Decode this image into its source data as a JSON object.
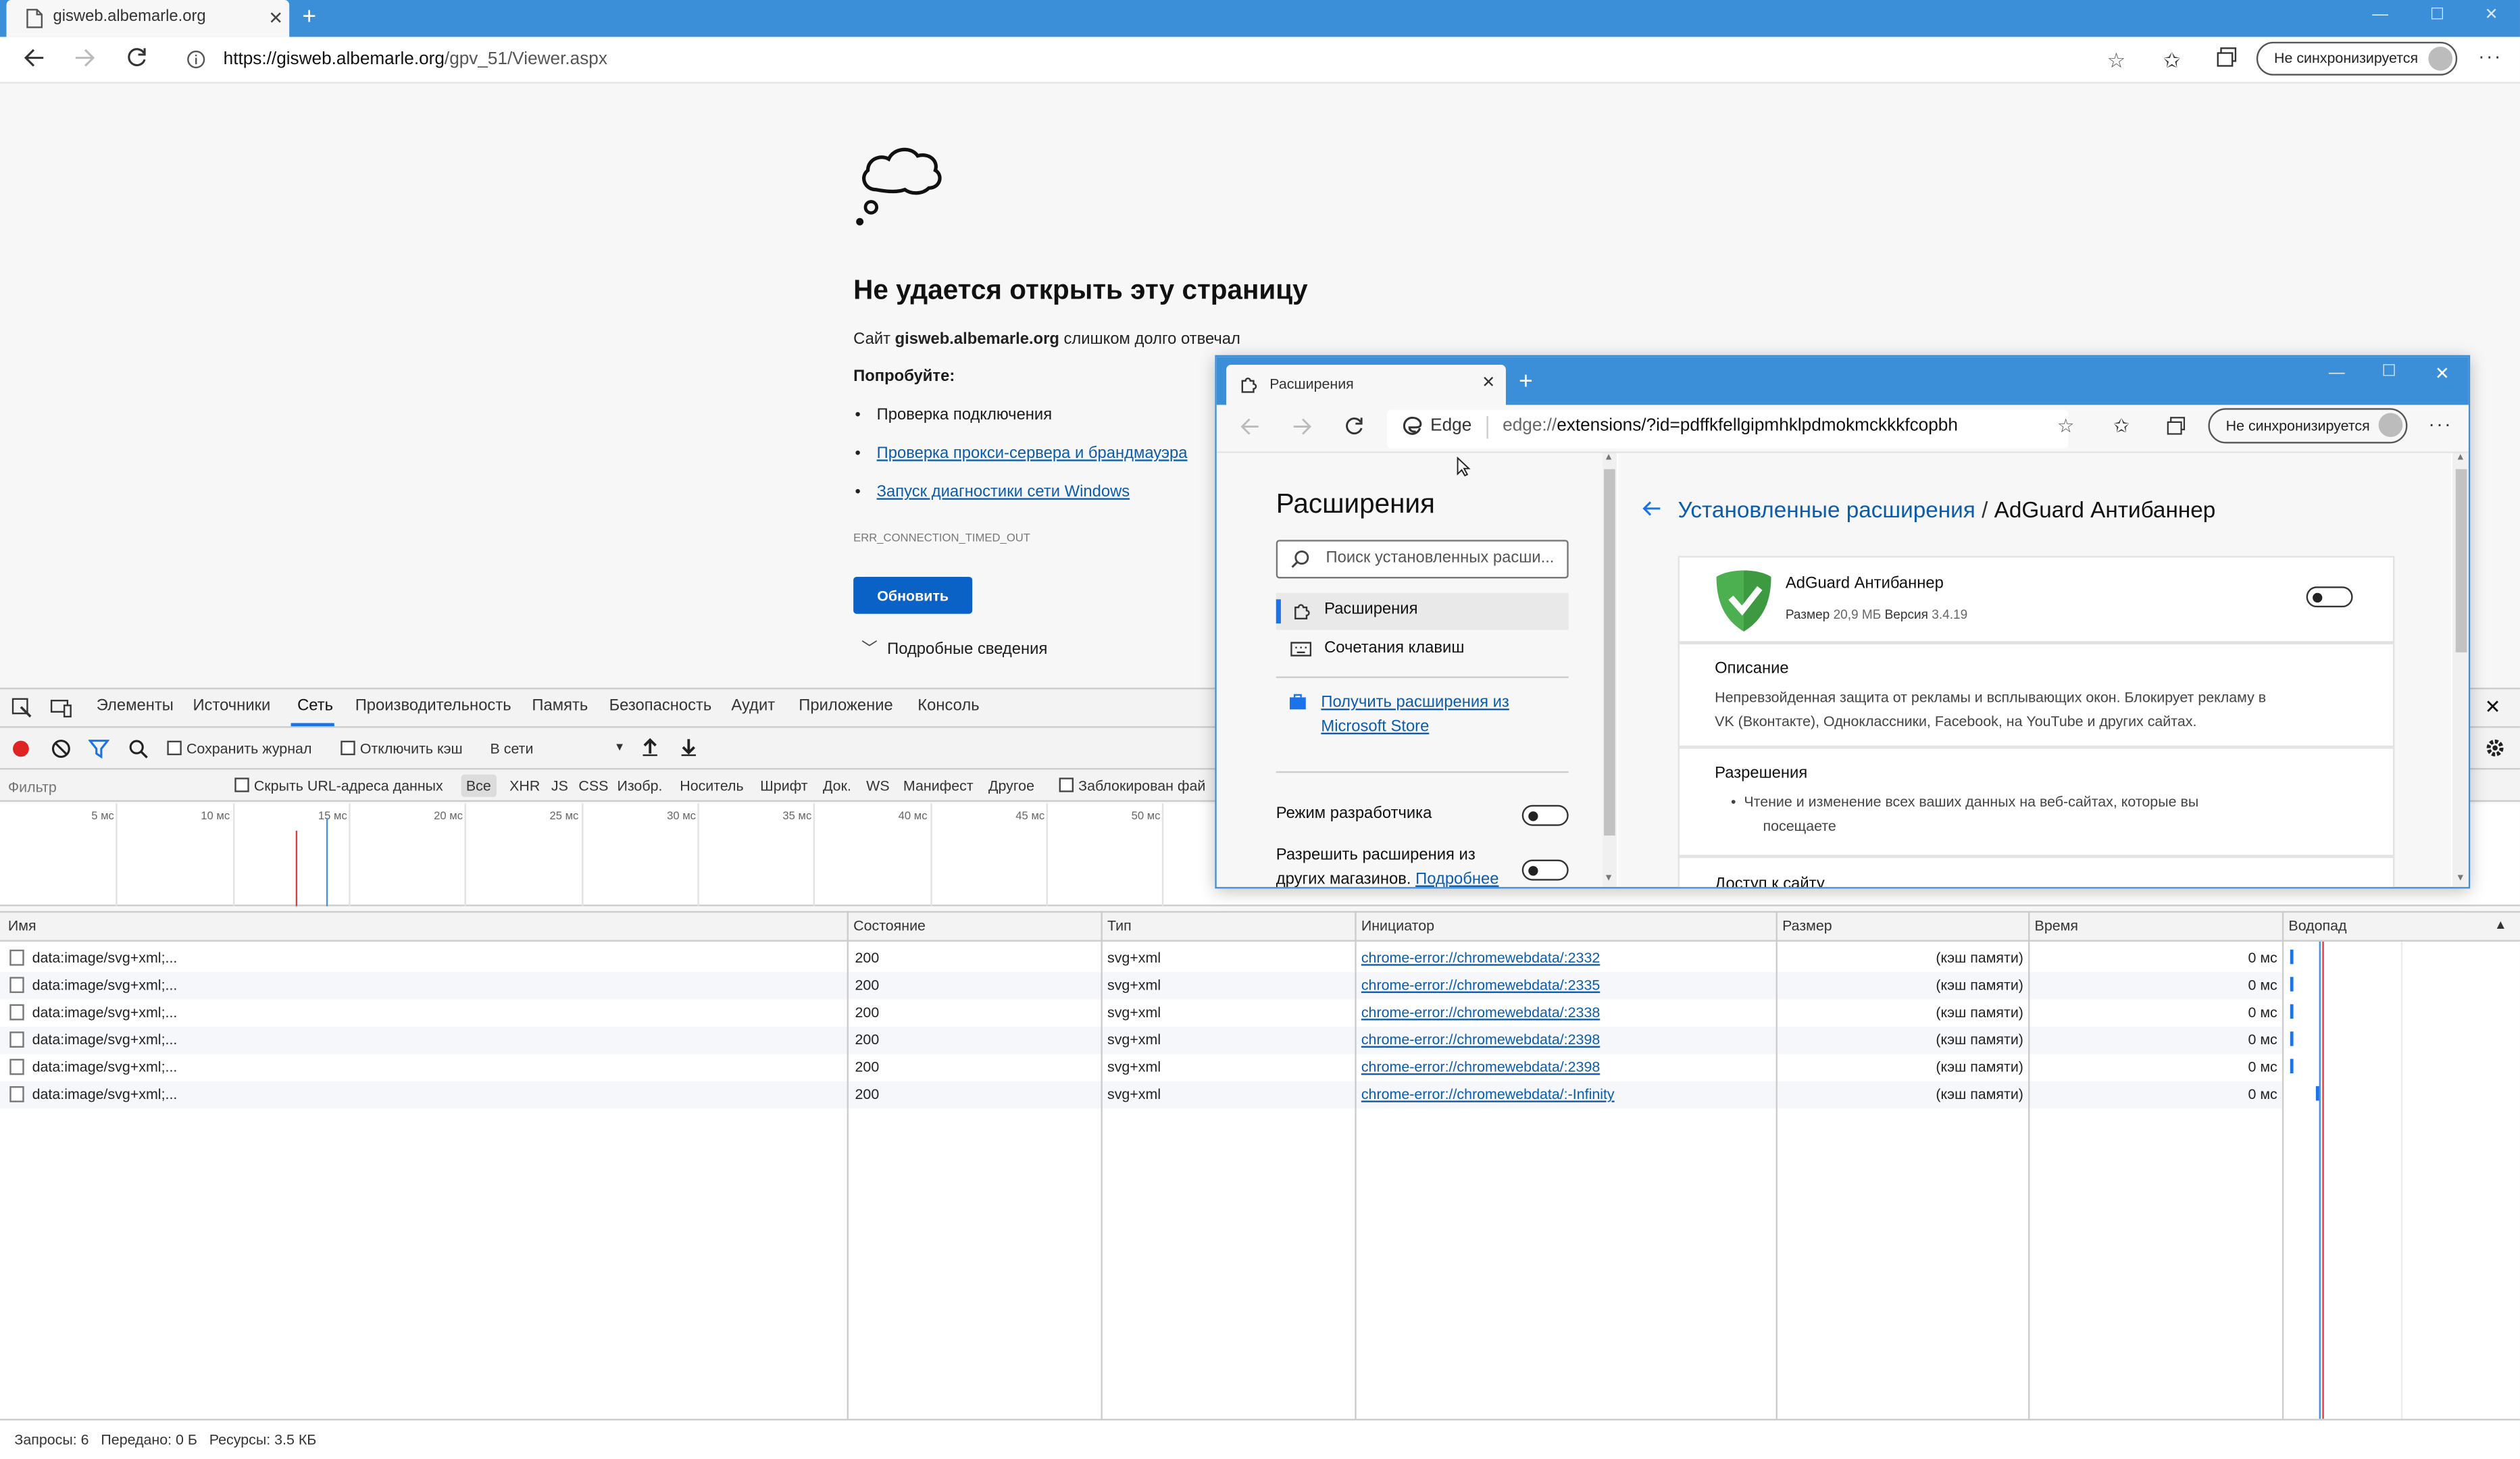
{
  "browser": {
    "tab_title": "gisweb.albemarle.org",
    "url_host": "https://gisweb.albemarle.org",
    "url_path": "/gpv_51/Viewer.aspx",
    "sync_label": "Не синхронизируется"
  },
  "error_page": {
    "title": "Не удается открыть эту страницу",
    "desc_prefix": "Сайт ",
    "desc_host": "gisweb.albemarle.org",
    "desc_suffix": " слишком долго отвечал",
    "try_label": "Попробуйте:",
    "suggestions": [
      "Проверка подключения",
      "Проверка прокси-сервера и брандмауэра",
      "Запуск диагностики сети Windows"
    ],
    "error_code": "ERR_CONNECTION_TIMED_OUT",
    "reload_label": "Обновить",
    "details_label": "Подробные сведения"
  },
  "devtools": {
    "tabs": [
      "Элементы",
      "Источники",
      "Сеть",
      "Производительность",
      "Память",
      "Безопасность",
      "Аудит",
      "Приложение",
      "Консоль"
    ],
    "active_tab": "Сеть",
    "toolbar": {
      "preserve_log": "Сохранить журнал",
      "disable_cache": "Отключить кэш",
      "throttle": "В сети"
    },
    "filter": {
      "placeholder": "Фильтр",
      "hide_data_urls": "Скрыть URL-адреса данных",
      "types": [
        "Все",
        "XHR",
        "JS",
        "CSS",
        "Изобр.",
        "Носитель",
        "Шрифт",
        "Док.",
        "WS",
        "Манифест",
        "Другое"
      ],
      "blocked": "Заблокирован фай"
    },
    "timeline_ticks": [
      "5 мс",
      "10 мс",
      "15 мс",
      "20 мс",
      "25 мс",
      "30 мс",
      "35 мс",
      "40 мс",
      "45 мс",
      "50 мс"
    ],
    "columns": [
      "Имя",
      "Состояние",
      "Тип",
      "Инициатор",
      "Размер",
      "Время",
      "Водопад"
    ],
    "rows": [
      {
        "name": "data:image/svg+xml;...",
        "status": "200",
        "type": "svg+xml",
        "initiator": "chrome-error://chromewebdata/:2332",
        "size": "(кэш памяти)",
        "time": "0 мс"
      },
      {
        "name": "data:image/svg+xml;...",
        "status": "200",
        "type": "svg+xml",
        "initiator": "chrome-error://chromewebdata/:2335",
        "size": "(кэш памяти)",
        "time": "0 мс"
      },
      {
        "name": "data:image/svg+xml;...",
        "status": "200",
        "type": "svg+xml",
        "initiator": "chrome-error://chromewebdata/:2338",
        "size": "(кэш памяти)",
        "time": "0 мс"
      },
      {
        "name": "data:image/svg+xml;...",
        "status": "200",
        "type": "svg+xml",
        "initiator": "chrome-error://chromewebdata/:2398",
        "size": "(кэш памяти)",
        "time": "0 мс"
      },
      {
        "name": "data:image/svg+xml;...",
        "status": "200",
        "type": "svg+xml",
        "initiator": "chrome-error://chromewebdata/:2398",
        "size": "(кэш памяти)",
        "time": "0 мс"
      },
      {
        "name": "data:image/svg+xml;...",
        "status": "200",
        "type": "svg+xml",
        "initiator": "chrome-error://chromewebdata/:-Infinity",
        "size": "(кэш памяти)",
        "time": "0 мс"
      }
    ],
    "status_bar": "Запросы: 6   Передано: 0 Б   Ресурсы: 3.5 КБ"
  },
  "extensions_window": {
    "tab_title": "Расширения",
    "edge_label": "Edge",
    "url_scheme": "edge://",
    "url_rest": "extensions/?id=pdffkfellgipmhklpdmokmckkkfcopbh",
    "sync_label": "Не синхронизируется",
    "sidebar": {
      "title": "Расширения",
      "search_placeholder": "Поиск установленных расши...",
      "nav": [
        "Расширения",
        "Сочетания клавиш"
      ],
      "store_link": "Получить расширения из Microsoft Store",
      "dev_mode": "Режим разработчика",
      "allow_other_1": "Разрешить расширения из",
      "allow_other_2": "других магазинов.",
      "more_link": "Подробнее"
    },
    "detail": {
      "breadcrumb_link": "Установленные расширения",
      "breadcrumb_sep": " / ",
      "breadcrumb_current": "AdGuard Антибаннер",
      "name": "AdGuard Антибаннер",
      "size_label": "Размер",
      "size_value": "20,9 МБ",
      "version_label": "Версия",
      "version_value": "3.4.19",
      "desc_title": "Описание",
      "desc_text_1": "Непревзойденная защита от рекламы и всплывающих окон. Блокирует рекламу в",
      "desc_text_2": "VK (Вконтакте), Одноклассники, Facebook, на YouTube и других сайтах.",
      "perm_title": "Разрешения",
      "perm_text_1": "Чтение и изменение всех ваших данных на веб-сайтах, которые вы",
      "perm_text_2": "посещаете",
      "site_access": "Доступ к сайту"
    }
  },
  "colors": {
    "accent": "#3b8fd8",
    "link": "#0b5cad",
    "button": "#0a62c7",
    "adguard_green": "#4caf50"
  }
}
